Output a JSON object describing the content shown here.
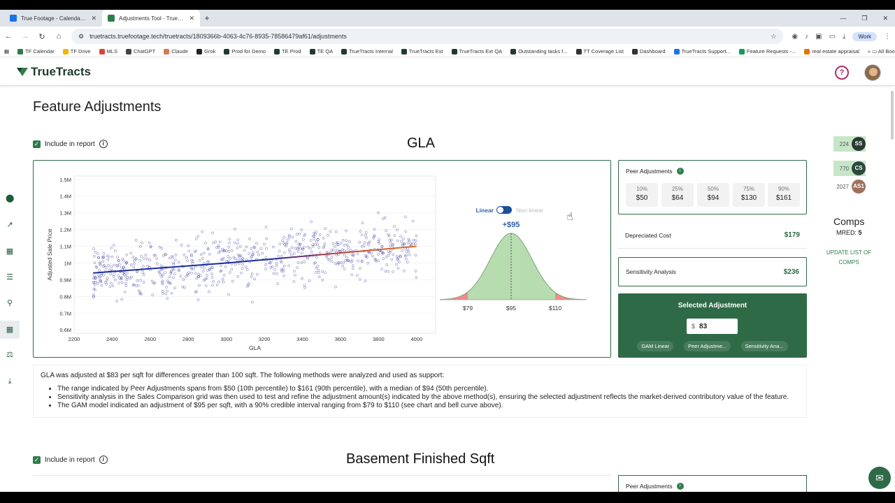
{
  "browser": {
    "tabs": [
      {
        "title": "True Footage - Calendar - Week",
        "active": false,
        "color": "#1a73e8"
      },
      {
        "title": "Adjustments Tool - TrueTracts",
        "active": true,
        "color": "#2e7d4a"
      }
    ],
    "url": "truetracts.truefootage.tech/truetracts/1809366b-4063-4c76-8935-78586479af61/adjustments",
    "profile": "Work",
    "bookmarks": [
      "TF Calendar",
      "TF Drive",
      "MLS",
      "ChatGPT",
      "Claude",
      "Grok",
      "Prod for Demo",
      "TE Prod",
      "TE QA",
      "TrueTracts Internal",
      "TrueTracts Ext",
      "TrueTracts Ext QA",
      "Outstanding tasks f...",
      "TT Coverage List",
      "Dashboard",
      "TrueTracts Support...",
      "Feature Requests -...",
      "real estate appraisal"
    ],
    "all_bookmarks": "All Bookmarks"
  },
  "app": {
    "brand": "TrueTracts",
    "help_icon": "help-icon",
    "page_title": "Feature Adjustments"
  },
  "sections": [
    {
      "include_label": "Include in report",
      "title": "GLA",
      "toggle": {
        "linear": "Linear",
        "nonlinear": "Non-linear"
      },
      "bell": {
        "center_label": "+$95",
        "low": "$79",
        "mid": "$95",
        "high": "$110"
      },
      "peer": {
        "title": "Peer Adjustments",
        "percentiles": [
          {
            "p": "10%",
            "v": "$50"
          },
          {
            "p": "25%",
            "v": "$64"
          },
          {
            "p": "50%",
            "v": "$94"
          },
          {
            "p": "75%",
            "v": "$130"
          },
          {
            "p": "90%",
            "v": "$161"
          }
        ]
      },
      "depreciated": {
        "label": "Depreciated Cost",
        "value": "$179"
      },
      "sensitivity": {
        "label": "Sensitivity Analysis",
        "value": "$236"
      },
      "selected": {
        "title": "Selected Adjustment",
        "currency": "$",
        "value": "83",
        "chips": [
          "GAM Linear",
          "Peer Adjustme...",
          "Sensitivity Ana..."
        ]
      },
      "narrative": {
        "intro": "GLA was adjusted at $83 per sqft for differences greater than 100 sqft. The following methods were analyzed and used as support:",
        "bullets": [
          "The range indicated by Peer Adjustments spans from $50 (10th percentile) to $161 (90th percentile), with a median of $94 (50th percentile).",
          "Sensitivity analysis in the Sales Comparison grid was then used to test and refine the adjustment amount(s) indicated by the above method(s), ensuring the selected adjustment reflects the market-derived contributory value of the feature.",
          "The GAM model indicated an adjustment of $95 per sqft, with a 90% credible interval ranging from $79 to $110 (see chart and bell curve above)."
        ]
      }
    },
    {
      "include_label": "Include in report",
      "title": "Basement Finished Sqft",
      "peer_title": "Peer Adjustments"
    }
  ],
  "comps": {
    "items": [
      {
        "count": "224",
        "badge": "SS",
        "color": "#2b3a33"
      },
      {
        "count": "770",
        "badge": "CS",
        "color": "#2b4a3a"
      },
      {
        "count": "2027",
        "badge": "AS1",
        "color": "#a0705a"
      }
    ],
    "title": "Comps",
    "mred_label": "MRED:",
    "mred_value": "5",
    "update_link": "UPDATE LIST OF COMPS"
  },
  "chart_data": {
    "type": "scatter",
    "xlabel": "GLA",
    "ylabel": "Adjusted Sale Price",
    "xlim": [
      2200,
      4100
    ],
    "ylim": [
      0.58,
      1.52
    ],
    "xticks": [
      "2200",
      "2400",
      "2600",
      "2800",
      "3000",
      "3200",
      "3400",
      "3600",
      "3800",
      "4000"
    ],
    "yticks": [
      "1.5M",
      "1.4M",
      "1.3M",
      "1.2M",
      "1.1M",
      "1M",
      "0.9M",
      "0.8M",
      "0.7M",
      "0.6M"
    ],
    "fit": {
      "x": [
        2300,
        3000,
        3500,
        4000
      ],
      "y": [
        0.94,
        1.0,
        1.05,
        1.1
      ],
      "color_low": "#1a2a9a",
      "color_high": "#e07020"
    },
    "n_points": 700,
    "point_color": "#3a3aa0"
  }
}
